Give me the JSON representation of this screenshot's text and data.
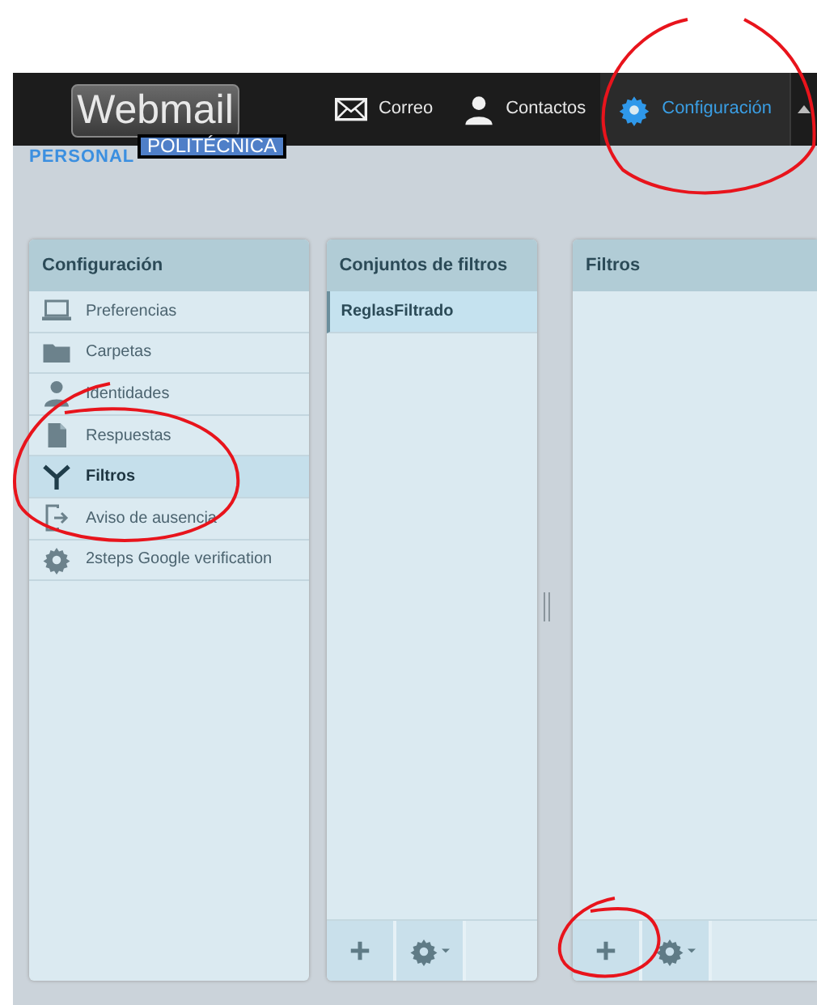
{
  "header": {
    "logo": "Webmail",
    "logo_badge": "POLITÉCNICA",
    "subtitle": "PERSONAL",
    "nav": [
      {
        "kind": "mail",
        "label": "Correo",
        "selected": false
      },
      {
        "kind": "person",
        "label": "Contactos",
        "selected": false
      },
      {
        "kind": "gear",
        "label": "Configuración",
        "selected": true
      }
    ]
  },
  "settings_panel": {
    "title": "Configuración",
    "items": [
      {
        "kind": "laptop",
        "label": "Preferencias",
        "selected": false
      },
      {
        "kind": "folder",
        "label": "Carpetas",
        "selected": false
      },
      {
        "kind": "person",
        "label": "Identidades",
        "selected": false
      },
      {
        "kind": "document",
        "label": "Respuestas",
        "selected": false
      },
      {
        "kind": "funnel",
        "label": "Filtros",
        "selected": true
      },
      {
        "kind": "exit",
        "label": "Aviso de ausencia",
        "selected": false
      },
      {
        "kind": "gear",
        "label": "2steps Google verification",
        "selected": false
      }
    ]
  },
  "filter_sets_panel": {
    "title": "Conjuntos de filtros",
    "items": [
      {
        "label": "ReglasFiltrado",
        "selected": true
      }
    ],
    "footer": [
      {
        "kind": "add"
      },
      {
        "kind": "settings"
      }
    ]
  },
  "filters_panel": {
    "title": "Filtros",
    "footer": [
      {
        "kind": "add"
      },
      {
        "kind": "settings"
      }
    ]
  }
}
